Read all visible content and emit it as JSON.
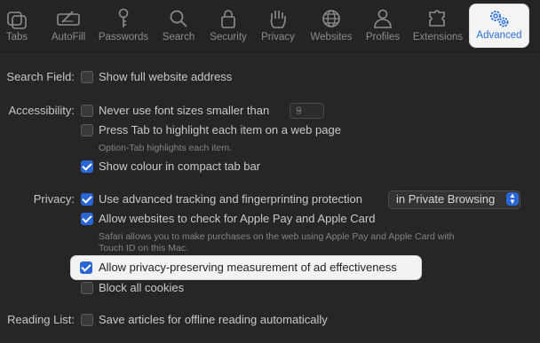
{
  "toolbar": {
    "items": [
      {
        "label": "Tabs"
      },
      {
        "label": "AutoFill"
      },
      {
        "label": "Passwords"
      },
      {
        "label": "Search"
      },
      {
        "label": "Security"
      },
      {
        "label": "Privacy"
      },
      {
        "label": "Websites"
      },
      {
        "label": "Profiles"
      },
      {
        "label": "Extensions"
      },
      {
        "label": "Advanced"
      }
    ]
  },
  "search_field": {
    "label": "Search Field:",
    "show_full_address": {
      "text": "Show full website address",
      "checked": false
    }
  },
  "accessibility": {
    "label": "Accessibility:",
    "font_size": {
      "text": "Never use font sizes smaller than",
      "checked": false,
      "value": "9"
    },
    "press_tab": {
      "text": "Press Tab to highlight each item on a web page",
      "checked": false
    },
    "press_tab_hint": "Option-Tab highlights each item.",
    "show_colour": {
      "text": "Show colour in compact tab bar",
      "checked": true
    }
  },
  "privacy": {
    "label": "Privacy:",
    "tracking": {
      "text": "Use advanced tracking and fingerprinting protection",
      "checked": true,
      "scope": "in Private Browsing"
    },
    "apple_pay": {
      "text": "Allow websites to check for Apple Pay and Apple Card",
      "checked": true
    },
    "apple_pay_hint_1": "Safari allows you to make purchases on the web using Apple Pay and Apple Card with",
    "apple_pay_hint_2": "Touch ID on this Mac.",
    "ad_measurement": {
      "text": "Allow privacy-preserving measurement of ad effectiveness",
      "checked": true
    },
    "block_cookies": {
      "text": "Block all cookies",
      "checked": false
    }
  },
  "reading_list": {
    "label": "Reading List:",
    "offline": {
      "text": "Save articles for offline reading automatically",
      "checked": false
    }
  },
  "colors": {
    "accent": "#2b66d6",
    "background": "#262626"
  }
}
